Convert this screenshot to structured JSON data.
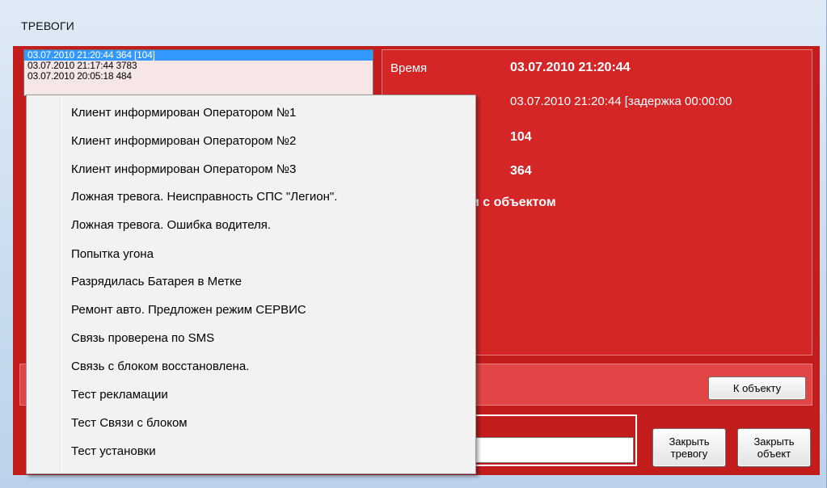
{
  "window": {
    "title": "ТРЕВОГИ"
  },
  "alarms": [
    {
      "text": "03.07.2010 21:20:44  364 [104]",
      "selected": true
    },
    {
      "text": "03.07.2010 21:17:44  3783",
      "selected": false
    },
    {
      "text": "03.07.2010 20:05:18  484",
      "selected": false
    }
  ],
  "details": {
    "time_label": "Время",
    "time_value": "03.07.2010 21:20:44",
    "received_value": "03.07.2010 21:20:44 [задержка 00:00:00",
    "zone_value": "104",
    "object_value": "364",
    "action_value": "и с объектом"
  },
  "buttons": {
    "to_object": "К объекту",
    "close_alarm_line1": "Закрыть",
    "close_alarm_line2": "тревогу",
    "close_object_line1": "Закрыть",
    "close_object_line2": "объект"
  },
  "context_menu": {
    "items": [
      "Клиент информирован Оператором №1",
      "Клиент информирован Оператором №2",
      "Клиент информирован Оператором №3",
      "Ложная тревога. Неисправность СПС \"Легион\".",
      "Ложная тревога. Ошибка водителя.",
      "Попытка угона",
      "Разрядилась Батарея в Метке",
      "Ремонт авто. Предложен режим СЕРВИС",
      "Связь проверена по SMS",
      "Связь с блоком восстановлена.",
      "Тест рекламации",
      "Тест Связи с блоком",
      "Тест установки"
    ]
  },
  "colors": {
    "panel_red": "#c21c1c",
    "details_red": "#d42626",
    "selection_blue": "#3399ff",
    "list_background": "#f6e6e6"
  }
}
